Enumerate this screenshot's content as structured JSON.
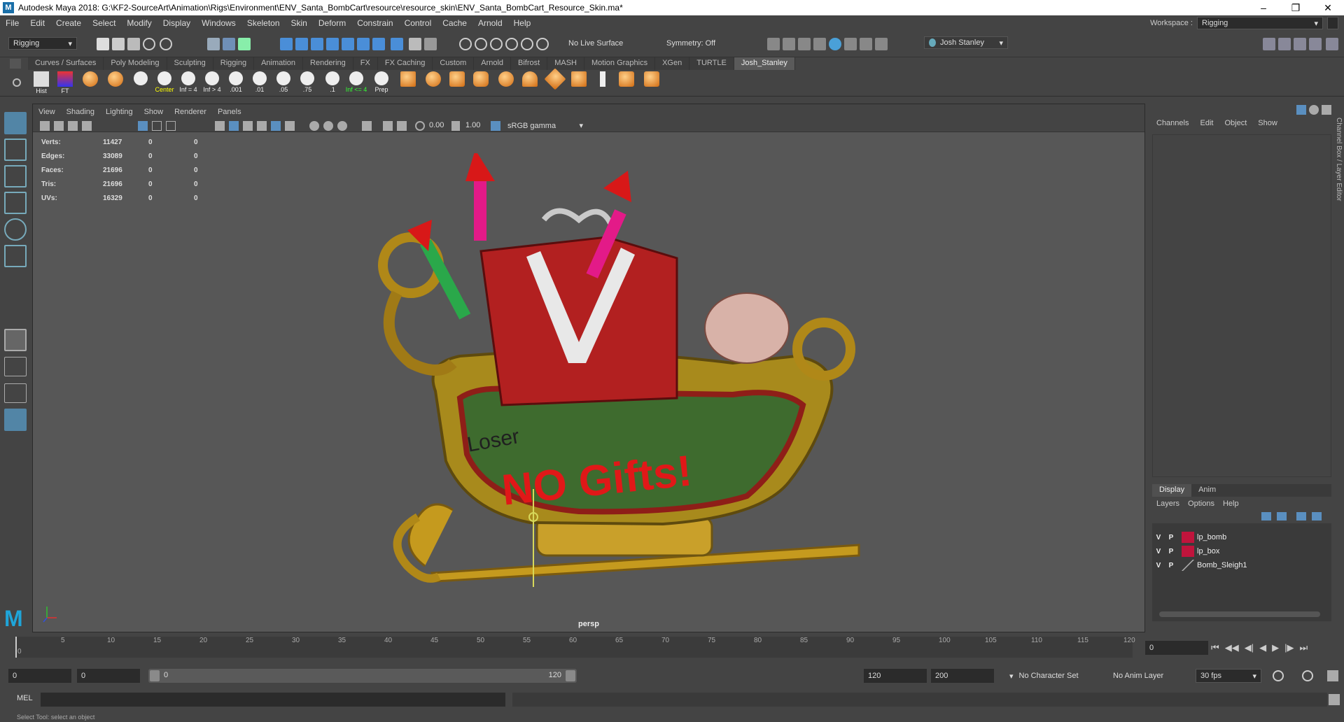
{
  "window": {
    "title": "Autodesk Maya 2018: G:\\KF2-SourceArt\\Animation\\Rigs\\Environment\\ENV_Santa_BombCart\\resource\\resource_skin\\ENV_Santa_BombCart_Resource_Skin.ma*"
  },
  "menubar": {
    "items": [
      "File",
      "Edit",
      "Create",
      "Select",
      "Modify",
      "Display",
      "Windows",
      "Skeleton",
      "Skin",
      "Deform",
      "Constrain",
      "Control",
      "Cache",
      "Arnold",
      "Help"
    ],
    "workspace_label": "Workspace :",
    "workspace_value": "Rigging"
  },
  "statusline": {
    "menuset": "Rigging",
    "live_surface": "No Live Surface",
    "symmetry": "Symmetry: Off",
    "user": "Josh Stanley"
  },
  "shelf": {
    "tabs": [
      "Curves / Surfaces",
      "Poly Modeling",
      "Sculpting",
      "Rigging",
      "Animation",
      "Rendering",
      "FX",
      "FX Caching",
      "Custom",
      "Arnold",
      "Bifrost",
      "MASH",
      "Motion Graphics",
      "XGen",
      "TURTLE",
      "Josh_Stanley"
    ],
    "active_tab": "Josh_Stanley",
    "buttons": [
      "Hist",
      "FT",
      "",
      "",
      "",
      "Center",
      "Inf = 4",
      "Inf > 4",
      ".001",
      ".01",
      ".05",
      ".75",
      ".1",
      "Inf <= 4",
      "Prep"
    ]
  },
  "viewport": {
    "menus": [
      "View",
      "Shading",
      "Lighting",
      "Show",
      "Renderer",
      "Panels"
    ],
    "exposure": "0.00",
    "gamma": "1.00",
    "color_space": "sRGB gamma",
    "camera_label": "persp",
    "hud": [
      {
        "label": "Verts:",
        "v1": "11427",
        "v2": "0",
        "v3": "0"
      },
      {
        "label": "Edges:",
        "v1": "33089",
        "v2": "0",
        "v3": "0"
      },
      {
        "label": "Faces:",
        "v1": "21696",
        "v2": "0",
        "v3": "0"
      },
      {
        "label": "Tris:",
        "v1": "21696",
        "v2": "0",
        "v3": "0"
      },
      {
        "label": "UVs:",
        "v1": "16329",
        "v2": "0",
        "v3": "0"
      }
    ],
    "graffiti_1": "Loser",
    "graffiti_2": "NO Gifts!"
  },
  "channelbox": {
    "menus": [
      "Channels",
      "Edit",
      "Object",
      "Show"
    ],
    "side_label": "Channel Box / Layer Editor"
  },
  "layers": {
    "tabs": [
      "Display",
      "Anim"
    ],
    "menus": [
      "Layers",
      "Options",
      "Help"
    ],
    "rows": [
      {
        "v": "V",
        "p": "P",
        "name": "lp_bomb",
        "color": "#c0143c"
      },
      {
        "v": "V",
        "p": "P",
        "name": "lp_box",
        "color": "#c0143c"
      },
      {
        "v": "V",
        "p": "P",
        "name": "Bomb_Sleigh1",
        "color": ""
      }
    ]
  },
  "timeslider": {
    "ticks": [
      "5",
      "10",
      "15",
      "20",
      "25",
      "30",
      "35",
      "40",
      "45",
      "50",
      "55",
      "60",
      "65",
      "70",
      "75",
      "80",
      "85",
      "90",
      "95",
      "100",
      "105",
      "110",
      "115",
      "120"
    ],
    "current_frame": "0",
    "current_field": "0",
    "start_label": "0"
  },
  "range": {
    "start_outer": "0",
    "start_inner": "0",
    "range_start": "0",
    "range_end": "120",
    "end_inner": "120",
    "end_outer": "200",
    "character_set": "No Character Set",
    "anim_layer": "No Anim Layer",
    "fps": "30 fps"
  },
  "mel": {
    "label": "MEL"
  },
  "helpline": {
    "text": "Select Tool: select an object"
  }
}
